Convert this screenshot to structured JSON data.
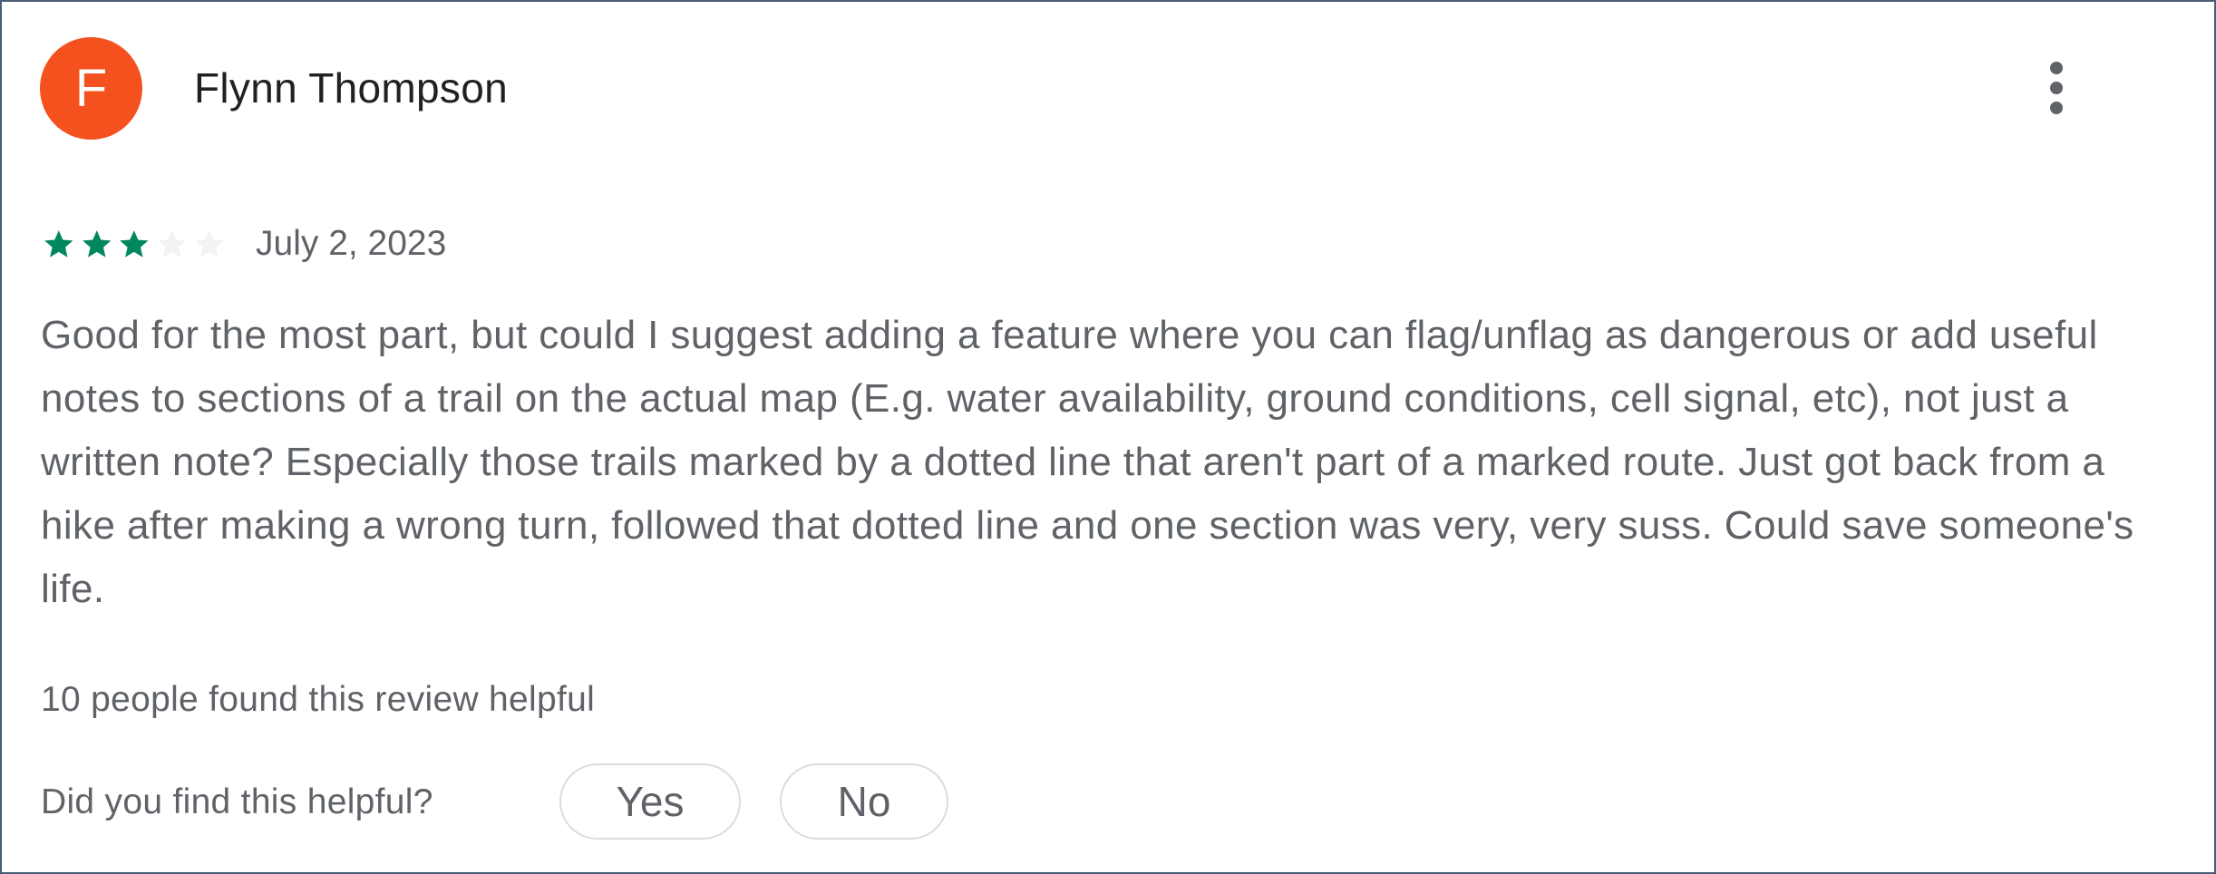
{
  "review": {
    "avatar_initial": "F",
    "reviewer_name": "Flynn Thompson",
    "rating": 3,
    "max_rating": 5,
    "date": "July 2, 2023",
    "text": "Good for the most part, but could I suggest adding a feature where you can flag/unflag as dangerous or add useful notes to sections of a trail on the actual map (E.g. water availability, ground conditions, cell signal, etc), not just a written note? Especially those trails marked by a dotted line that aren't part of a marked route. Just got back from a hike after making a wrong turn, followed that dotted line and one section was very, very suss. Could save someone's life.",
    "helpful_count_text": "10 people found this review helpful"
  },
  "feedback": {
    "prompt": "Did you find this helpful?",
    "yes_label": "Yes",
    "no_label": "No"
  },
  "icons": {
    "more": "more-vert-icon",
    "star_filled": "star-filled-icon",
    "star_empty": "star-empty-icon"
  },
  "colors": {
    "avatar_bg": "#f4511e",
    "star_filled": "#01875f",
    "star_empty": "#f1f3f4",
    "text_primary": "#202124",
    "text_secondary": "#5f6368",
    "button_border": "#dadce0",
    "frame_border": "#4a5b74"
  }
}
